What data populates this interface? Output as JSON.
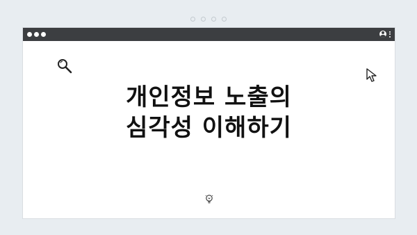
{
  "title": {
    "line1": "개인정보 노출의",
    "line2": "심각성 이해하기"
  },
  "icons": {
    "search": "search-icon",
    "cursor": "cursor-icon",
    "bulb": "lightbulb-icon",
    "user": "user-icon",
    "menu": "kebab-menu-icon"
  },
  "colors": {
    "frame_bg": "#e8edf1",
    "toolbar_bg": "#3c3e41",
    "page_bg": "#ffffff",
    "text": "#111111"
  }
}
